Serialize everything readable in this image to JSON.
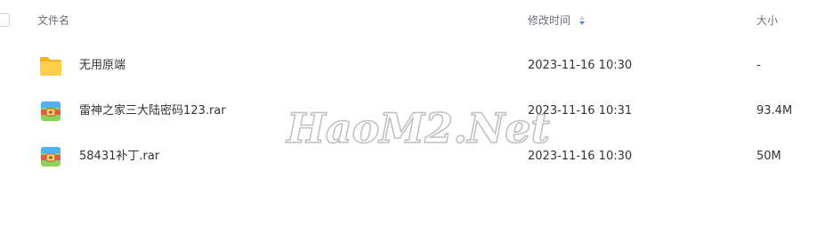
{
  "header": {
    "name_label": "文件名",
    "time_label": "修改时间",
    "size_label": "大小"
  },
  "icons": {
    "sort": "sort-icon",
    "folder": "folder-icon",
    "archive": "archive-icon"
  },
  "files": [
    {
      "name": "无用原端",
      "time": "2023-11-16 10:30",
      "size": "-",
      "type": "folder"
    },
    {
      "name": "雷神之家三大陆密码123.rar",
      "time": "2023-11-16 10:31",
      "size": "93.4M",
      "type": "archive"
    },
    {
      "name": "58431补丁.rar",
      "time": "2023-11-16 10:30",
      "size": "50M",
      "type": "archive"
    }
  ],
  "watermark": {
    "text": "HaoM2.Net"
  },
  "colors": {
    "folder": "#ffc83d",
    "archive_top": "#4fb0f5",
    "archive_body": "#8bd35a",
    "archive_band": "#e8594a",
    "sort_arrow": "#3a8ee6"
  }
}
